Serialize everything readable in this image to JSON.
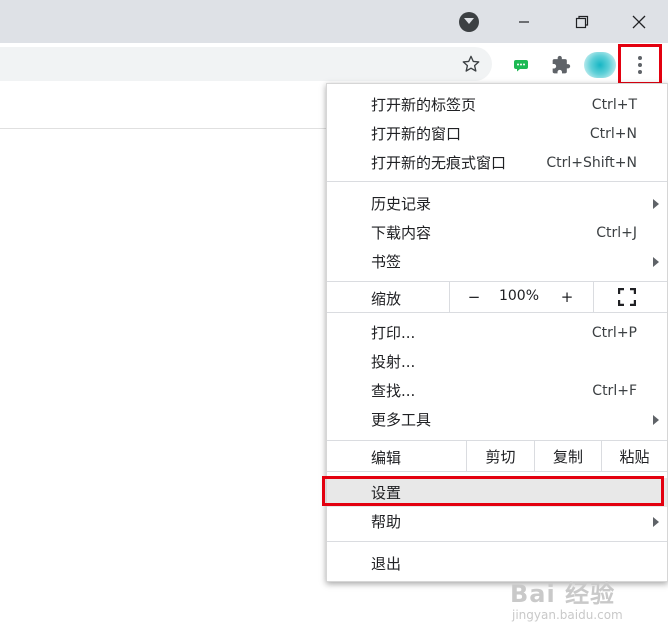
{
  "colors": {
    "highlight": "#e3000f",
    "titlebar": "#dee1e6",
    "omnibox": "#f1f3f4",
    "menu_hover": "#e8e8e8"
  },
  "menu": {
    "group1": [
      {
        "label": "打开新的标签页",
        "shortcut": "Ctrl+T"
      },
      {
        "label": "打开新的窗口",
        "shortcut": "Ctrl+N"
      },
      {
        "label": "打开新的无痕式窗口",
        "shortcut": "Ctrl+Shift+N"
      }
    ],
    "group2": [
      {
        "label": "历史记录",
        "shortcut": "",
        "submenu": true
      },
      {
        "label": "下载内容",
        "shortcut": "Ctrl+J"
      },
      {
        "label": "书签",
        "shortcut": "",
        "submenu": true
      }
    ],
    "zoom": {
      "label": "缩放",
      "minus": "−",
      "value": "100%",
      "plus": "+",
      "fullscreen_icon": "fullscreen-icon"
    },
    "group3": [
      {
        "label": "打印...",
        "shortcut": "Ctrl+P"
      },
      {
        "label": "投射...",
        "shortcut": ""
      },
      {
        "label": "查找...",
        "shortcut": "Ctrl+F"
      },
      {
        "label": "更多工具",
        "shortcut": "",
        "submenu": true
      }
    ],
    "edit": {
      "label": "编辑",
      "cut": "剪切",
      "copy": "复制",
      "paste": "粘贴"
    },
    "group4": [
      {
        "label": "设置",
        "selected": true
      },
      {
        "label": "帮助",
        "submenu": true
      }
    ],
    "exit": {
      "label": "退出"
    }
  },
  "watermark": {
    "main": "Bai 经验",
    "sub": "jingyan.baidu.com"
  }
}
